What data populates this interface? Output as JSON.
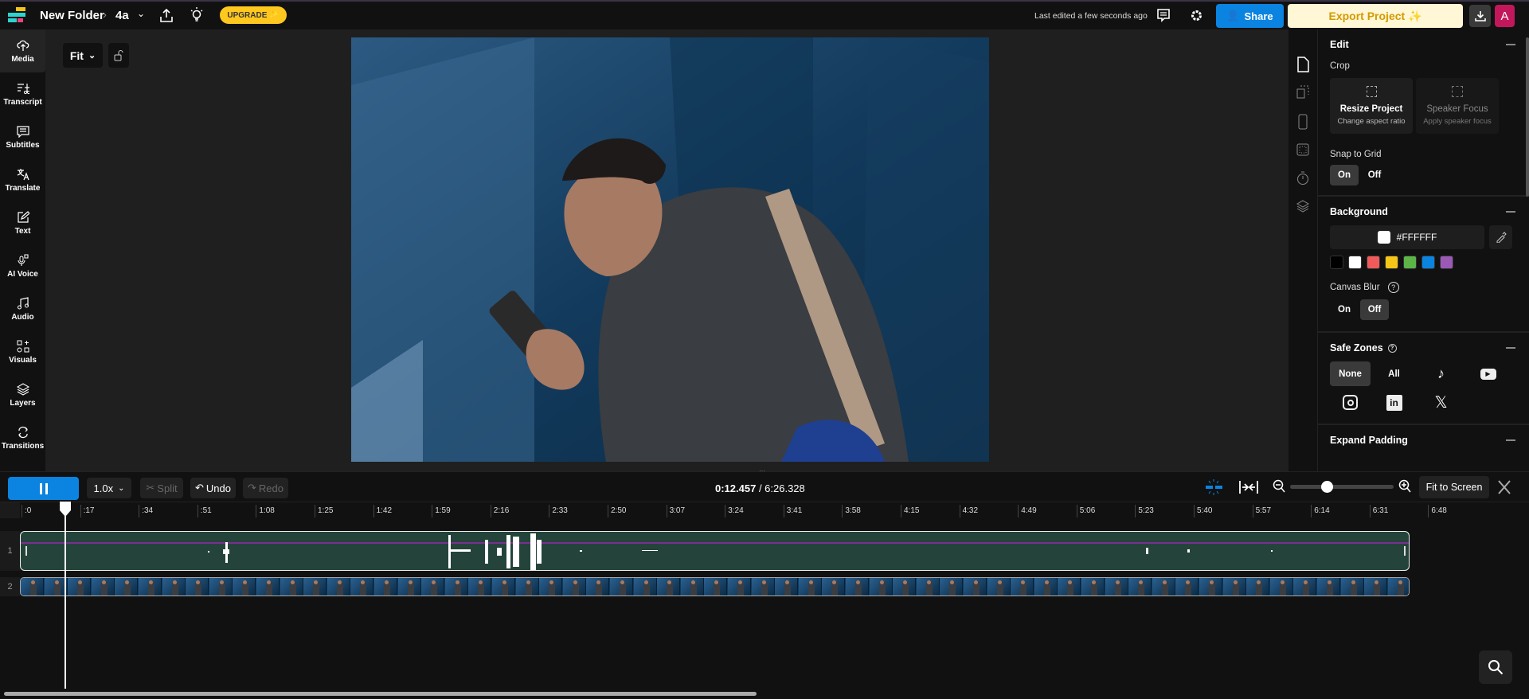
{
  "topbar": {
    "folder": "New Folder",
    "project": "4a",
    "upgrade": "UPGRADE ✨",
    "last_edited": "Last edited a few seconds ago",
    "share": "Share",
    "export": "Export Project ✨",
    "avatar": "A"
  },
  "canvas": {
    "fit": "Fit"
  },
  "sidebar": {
    "items": [
      {
        "label": "Media",
        "icon": "cloud-upload-icon"
      },
      {
        "label": "Transcript",
        "icon": "transcript-icon"
      },
      {
        "label": "Subtitles",
        "icon": "subtitles-icon"
      },
      {
        "label": "Translate",
        "icon": "translate-icon"
      },
      {
        "label": "Text",
        "icon": "text-icon"
      },
      {
        "label": "AI Voice",
        "icon": "microphone-icon"
      },
      {
        "label": "Audio",
        "icon": "music-icon"
      },
      {
        "label": "Visuals",
        "icon": "shapes-icon"
      },
      {
        "label": "Layers",
        "icon": "layers-icon"
      },
      {
        "label": "Transitions",
        "icon": "transitions-icon"
      }
    ]
  },
  "panel": {
    "edit": {
      "title": "Edit",
      "crop": "Crop",
      "resize_title": "Resize Project",
      "resize_sub": "Change aspect ratio",
      "speaker_title": "Speaker Focus",
      "speaker_sub": "Apply speaker focus",
      "snap": "Snap to Grid",
      "on": "On",
      "off": "Off"
    },
    "background": {
      "title": "Background",
      "hex": "#FFFFFF",
      "swatches": [
        "#000000",
        "#FFFFFF",
        "#F05A5A",
        "#F5C518",
        "#5DB547",
        "#0A84E0",
        "#9B59B6"
      ],
      "blur": "Canvas Blur",
      "on": "On",
      "off": "Off"
    },
    "safe": {
      "title": "Safe Zones",
      "none": "None",
      "all": "All"
    },
    "padding": {
      "title": "Expand Padding"
    }
  },
  "controls": {
    "speed": "1.0x",
    "split": "Split",
    "undo": "Undo",
    "redo": "Redo",
    "current": "0:12.457",
    "total": " / 6:26.328",
    "fit": "Fit to Screen",
    "zoom_level": 0.35
  },
  "ruler": [
    ":0",
    ":17",
    ":34",
    ":51",
    "1:08",
    "1:25",
    "1:42",
    "1:59",
    "2:16",
    "2:33",
    "2:50",
    "3:07",
    "3:24",
    "3:41",
    "3:58",
    "4:15",
    "4:32",
    "4:49",
    "5:06",
    "5:23",
    "5:40",
    "5:57",
    "6:14",
    "6:31",
    "6:48"
  ],
  "tracks": [
    "1",
    "2"
  ],
  "colors": {
    "accent": "#0A84E0",
    "upgrade": "#FFC81E",
    "export_bg": "#FFF7D6",
    "export_text": "#D49A00",
    "avatar": "#C2185B",
    "audio_track": "#24443B"
  }
}
